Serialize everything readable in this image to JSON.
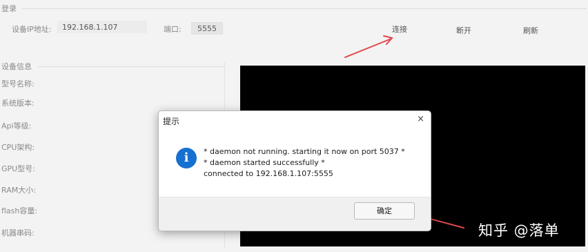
{
  "login": {
    "title": "登录",
    "ip_label": "设备IP地址:",
    "ip_value": "192.168.1.107",
    "port_label": "端口:",
    "port_value": "5555",
    "connect_label": "连接",
    "disconnect_label": "断开",
    "refresh_label": "刷新"
  },
  "device_info": {
    "title": "设备信息",
    "fields": [
      "型号名称:",
      "系统版本:",
      "Api等级:",
      "CPU架构:",
      "GPU型号:",
      "RAM大小:",
      "flash容量:",
      "机器串码:"
    ]
  },
  "dialog": {
    "title": "提示",
    "close_symbol": "×",
    "icon": "info-icon",
    "icon_glyph": "i",
    "messages": [
      "* daemon not running. starting it now on port 5037 *",
      "* daemon started successfully *",
      "connected to 192.168.1.107:5555"
    ],
    "ok_label": "确定"
  },
  "annotation_color": "#e0474c",
  "watermark": "知乎 @落单"
}
